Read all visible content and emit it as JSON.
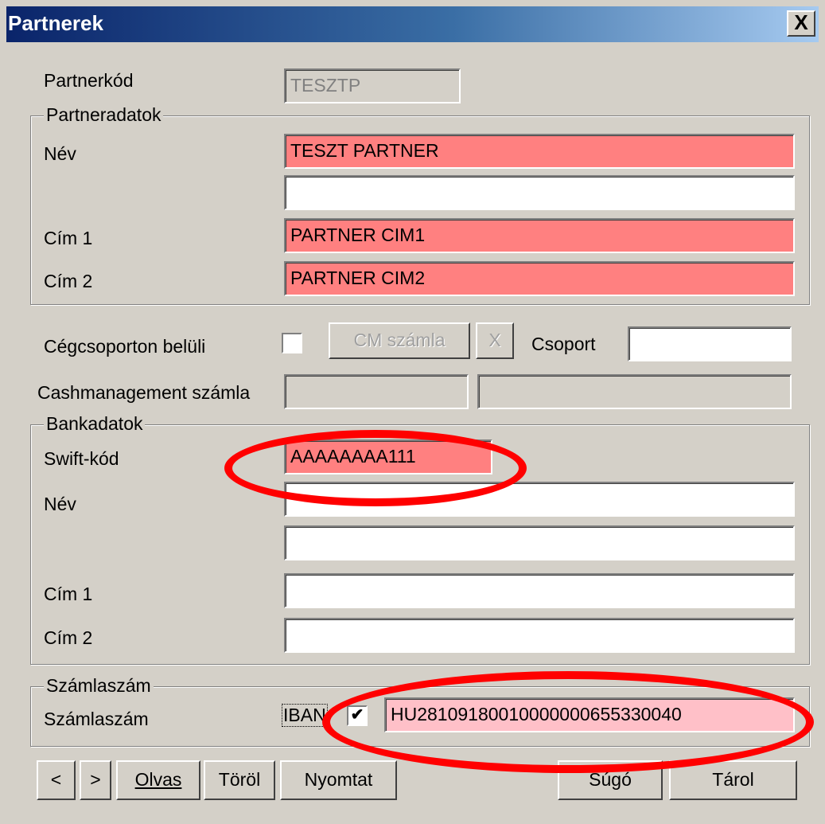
{
  "window": {
    "title": "Partnerek",
    "close_label": "X"
  },
  "partnerkod": {
    "label": "Partnerkód",
    "value": "TESZTP"
  },
  "partneradatok": {
    "title": "Partneradatok",
    "nev_label": "Név",
    "nev_value": "TESZT PARTNER",
    "nev2_value": "",
    "cim1_label": "Cím 1",
    "cim1_value": "PARTNER CIM1",
    "cim2_label": "Cím 2",
    "cim2_value": "PARTNER CIM2"
  },
  "cegcsoport": {
    "label": "Cégcsoporton belüli",
    "checked": "",
    "cm_button": "CM számla",
    "x_button": "X",
    "csoport_label": "Csoport",
    "csoport_value": ""
  },
  "cashmanagement": {
    "label": "Cashmanagement számla",
    "value1": "",
    "value2": ""
  },
  "bankadatok": {
    "title": "Bankadatok",
    "swift_label": "Swift-kód",
    "swift_value": "AAAAAAAA111",
    "nev_label": "Név",
    "nev_value": "",
    "nev2_value": "",
    "cim1_label": "Cím 1",
    "cim1_value": "",
    "cim2_label": "Cím 2",
    "cim2_value": ""
  },
  "szamlaszam": {
    "title": "Számlaszám",
    "label": "Számlaszám",
    "iban_label": "IBAN",
    "iban_checked": "✔",
    "value": "HU28109180010000000655330040"
  },
  "buttons": {
    "prev": "<",
    "next": ">",
    "olvas": "Olvas",
    "torol": "Töröl",
    "nyomtat": "Nyomtat",
    "sugo": "Súgó",
    "tarol": "Tárol"
  },
  "colors": {
    "highlight": "#ff8080",
    "annotation": "#ff0000",
    "titlebar": "#0a246a"
  }
}
